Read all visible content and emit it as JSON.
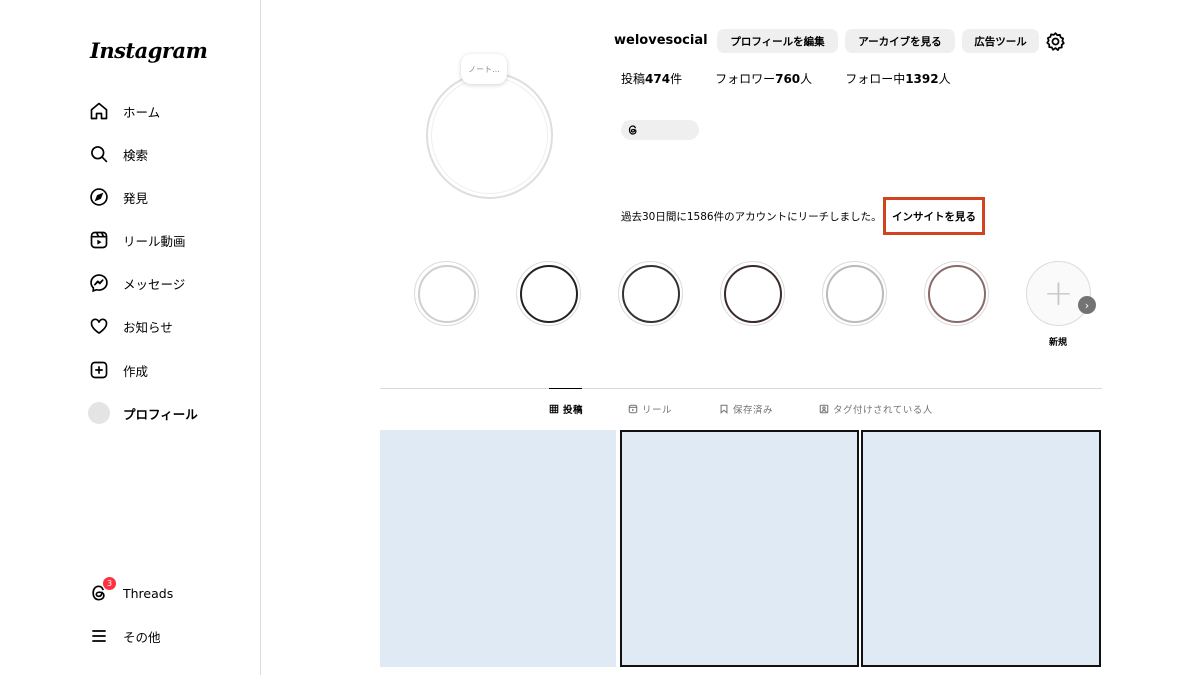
{
  "app": {
    "logo": "Instagram"
  },
  "sidebar": {
    "items": [
      {
        "label": "ホーム",
        "icon": "home-icon"
      },
      {
        "label": "検索",
        "icon": "search-icon"
      },
      {
        "label": "発見",
        "icon": "compass-icon"
      },
      {
        "label": "リール動画",
        "icon": "reels-icon"
      },
      {
        "label": "メッセージ",
        "icon": "messenger-icon"
      },
      {
        "label": "お知らせ",
        "icon": "heart-icon"
      },
      {
        "label": "作成",
        "icon": "create-icon"
      },
      {
        "label": "プロフィール",
        "icon": "avatar"
      }
    ],
    "bottom": [
      {
        "label": "Threads",
        "icon": "threads-icon",
        "badge": "3"
      },
      {
        "label": "その他",
        "icon": "menu-icon"
      }
    ]
  },
  "profile": {
    "note": "ノート...",
    "username": "welovesocial",
    "edit_button": "プロフィールを編集",
    "archive_button": "アーカイブを見る",
    "ad_tools_button": "広告ツール",
    "stats": {
      "posts_label": "投稿",
      "posts_value": "474",
      "posts_unit": "件",
      "followers_label": "フォロワー",
      "followers_value": "760",
      "followers_unit": "人",
      "following_label": "フォロー中",
      "following_value": "1392",
      "following_unit": "人"
    },
    "reach_text": "過去30日間に1586件のアカウントにリーチしました。",
    "insight_link": "インサイトを見る"
  },
  "highlights": {
    "new_label": "新規"
  },
  "tabs": [
    {
      "label": "投稿",
      "icon": "grid-icon",
      "active": true
    },
    {
      "label": "リール",
      "icon": "reels-icon",
      "active": false
    },
    {
      "label": "保存済み",
      "icon": "bookmark-icon",
      "active": false
    },
    {
      "label": "タグ付けされている人",
      "icon": "tag-person-icon",
      "active": false
    }
  ],
  "colors": {
    "highlight_border": "#d2431f",
    "badge": "#ff3040",
    "post_placeholder": "#dfeaf5"
  }
}
